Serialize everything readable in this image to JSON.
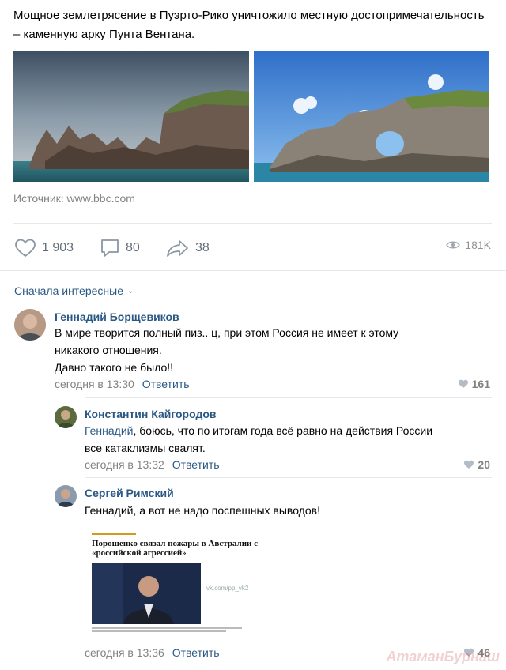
{
  "post": {
    "text": "Мощное землетрясение в Пуэрто-Рико уничтожило местную достопримечательность – каменную арку Пунта Вентана.",
    "source": "Источник: www.bbc.com",
    "likes": "1 903",
    "comments": "80",
    "shares": "38",
    "views": "181K"
  },
  "comments_header": {
    "sort_label": "Сначала интересные"
  },
  "comments": [
    {
      "author": "Геннадий Борщевиков",
      "text_line1": "В мире творится полный пиз.. ц, при этом Россия не имеет к этому",
      "text_line2": "никакого отношения.",
      "text_line3": "Давно такого не было!!",
      "time": "сегодня в 13:30",
      "reply": "Ответить",
      "likes": "161"
    },
    {
      "author": "Константин Кайгородов",
      "mention": "Геннадий",
      "text_line1": ", боюсь, что по итогам года всё равно на действия России",
      "text_line2": "все катаклизмы свалят.",
      "time": "сегодня в 13:32",
      "reply": "Ответить",
      "likes": "20"
    },
    {
      "author": "Сергей Римский",
      "text_line1": "Геннадий, а вот не надо поспешных выводов!",
      "time": "сегодня в 13:36",
      "reply": "Ответить",
      "likes": "46",
      "attachment": {
        "headline": "Порошенко связал пожары в Австралии с «российской агрессией»",
        "watermark": "vk.com/pp_vk2"
      }
    }
  ],
  "site_watermark": "АтаманБурнаш",
  "colors": {
    "link": "#2a5885",
    "muted": "#828282",
    "divider": "#e7e8ec"
  }
}
